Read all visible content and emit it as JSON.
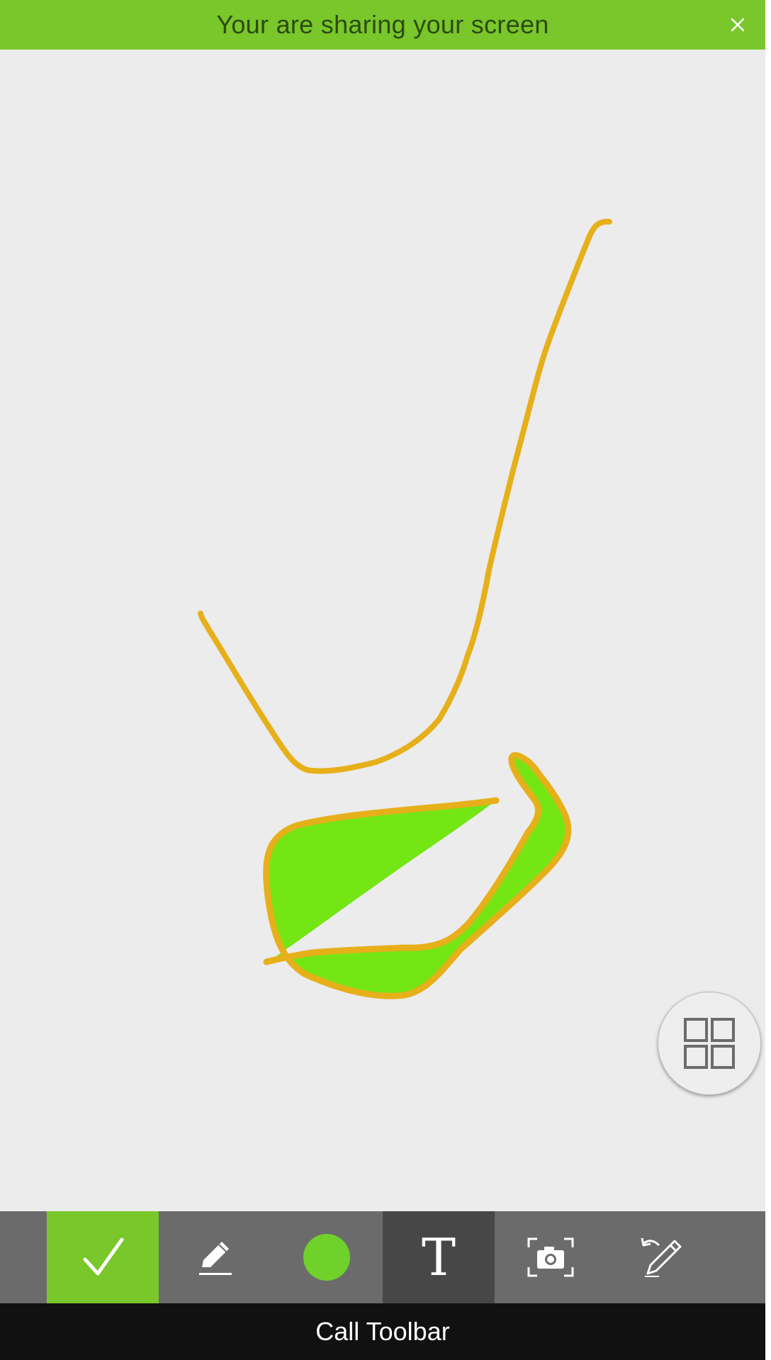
{
  "banner": {
    "text": "Your are sharing your screen",
    "close_icon": "close-icon",
    "color": "#79c72b"
  },
  "drawing": {
    "stroke_color": "#e6b01a",
    "fill_color": "#74e613"
  },
  "fab": {
    "icon": "grid-icon"
  },
  "toolbar": {
    "tools": [
      {
        "name": "confirm",
        "icon": "checkmark-icon"
      },
      {
        "name": "draw",
        "icon": "pencil-icon"
      },
      {
        "name": "color",
        "icon": "color-dot-icon",
        "value": "#6fd12a"
      },
      {
        "name": "text",
        "icon": "text-icon",
        "label": "T"
      },
      {
        "name": "screenshot",
        "icon": "camera-icon"
      },
      {
        "name": "undo-draw",
        "icon": "undo-pencil-icon"
      }
    ],
    "active_accent": "#79c72b"
  },
  "caption": {
    "text": "Call Toolbar"
  }
}
